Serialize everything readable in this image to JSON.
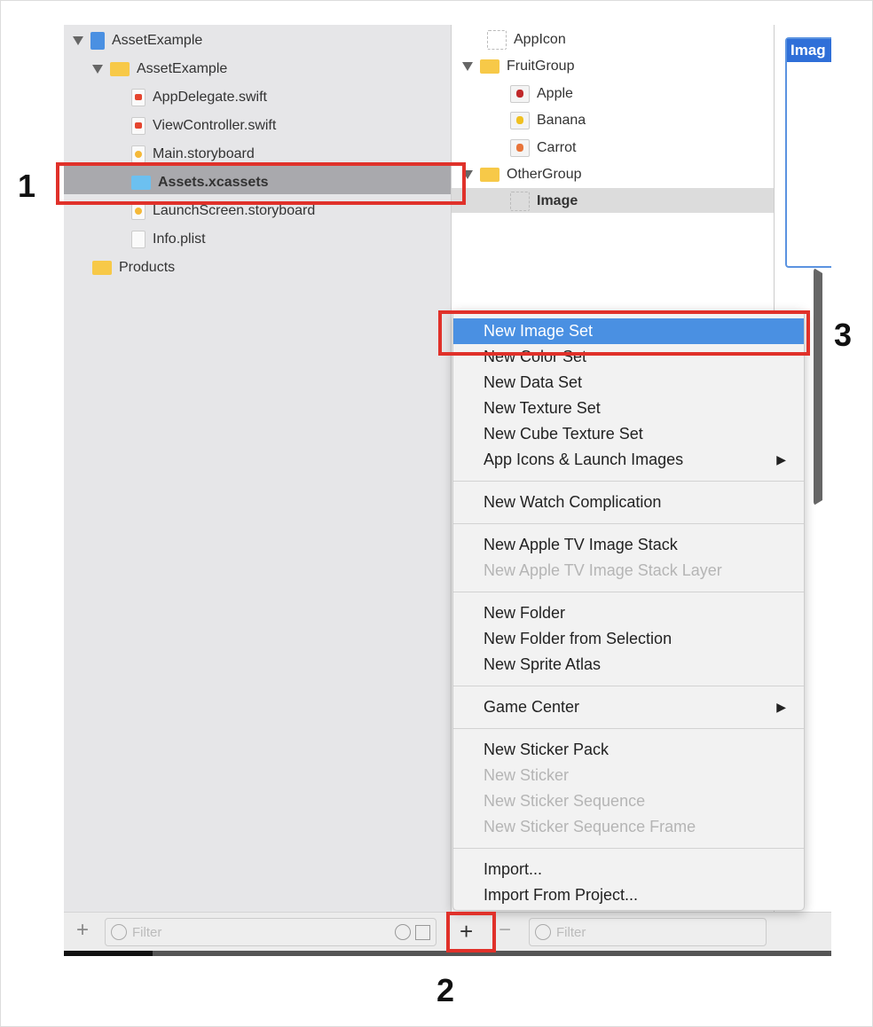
{
  "navigator": {
    "items": [
      {
        "label": "AssetExample",
        "icon": "project-icon",
        "expanded": true
      },
      {
        "label": "AssetExample",
        "icon": "folder-icon",
        "expanded": true
      },
      {
        "label": "AppDelegate.swift",
        "icon": "swift-file-icon"
      },
      {
        "label": "ViewController.swift",
        "icon": "swift-file-icon"
      },
      {
        "label": "Main.storyboard",
        "icon": "storyboard-icon"
      },
      {
        "label": "Assets.xcassets",
        "icon": "asset-catalog-icon",
        "selected": true
      },
      {
        "label": "LaunchScreen.storyboard",
        "icon": "storyboard-icon"
      },
      {
        "label": "Info.plist",
        "icon": "plist-icon"
      },
      {
        "label": "Products",
        "icon": "folder-icon",
        "expanded": false
      }
    ],
    "filter_placeholder": "Filter"
  },
  "assets": {
    "items": [
      {
        "label": "AppIcon",
        "icon": "appicon-placeholder-icon"
      },
      {
        "label": "FruitGroup",
        "icon": "folder-icon",
        "expanded": true
      },
      {
        "label": "Apple",
        "icon": "apple-thumbnail-icon"
      },
      {
        "label": "Banana",
        "icon": "banana-thumbnail-icon"
      },
      {
        "label": "Carrot",
        "icon": "carrot-thumbnail-icon"
      },
      {
        "label": "OtherGroup",
        "icon": "folder-icon",
        "expanded": true
      },
      {
        "label": "Image",
        "icon": "image-placeholder-icon",
        "selected": true
      }
    ],
    "filter_placeholder": "Filter",
    "add_label": "+",
    "remove_label": "−"
  },
  "detail": {
    "header": "Imag"
  },
  "menu": {
    "groups": [
      [
        {
          "label": "New Image Set",
          "highlighted": true
        },
        {
          "label": "New Color Set"
        },
        {
          "label": "New Data Set"
        },
        {
          "label": "New Texture Set"
        },
        {
          "label": "New Cube Texture Set"
        },
        {
          "label": "App Icons & Launch Images",
          "submenu": true
        }
      ],
      [
        {
          "label": "New Watch Complication"
        }
      ],
      [
        {
          "label": "New Apple TV Image Stack"
        },
        {
          "label": "New Apple TV Image Stack Layer",
          "disabled": true
        }
      ],
      [
        {
          "label": "New Folder"
        },
        {
          "label": "New Folder from Selection"
        },
        {
          "label": "New Sprite Atlas"
        }
      ],
      [
        {
          "label": "Game Center",
          "submenu": true
        }
      ],
      [
        {
          "label": "New Sticker Pack"
        },
        {
          "label": "New Sticker",
          "disabled": true
        },
        {
          "label": "New Sticker Sequence",
          "disabled": true
        },
        {
          "label": "New Sticker Sequence Frame",
          "disabled": true
        }
      ],
      [
        {
          "label": "Import..."
        },
        {
          "label": "Import From Project..."
        }
      ]
    ],
    "submenu_arrow": "▶"
  },
  "annotations": {
    "step1": "1",
    "step2": "2",
    "step3": "3",
    "color": "#e0312a"
  }
}
